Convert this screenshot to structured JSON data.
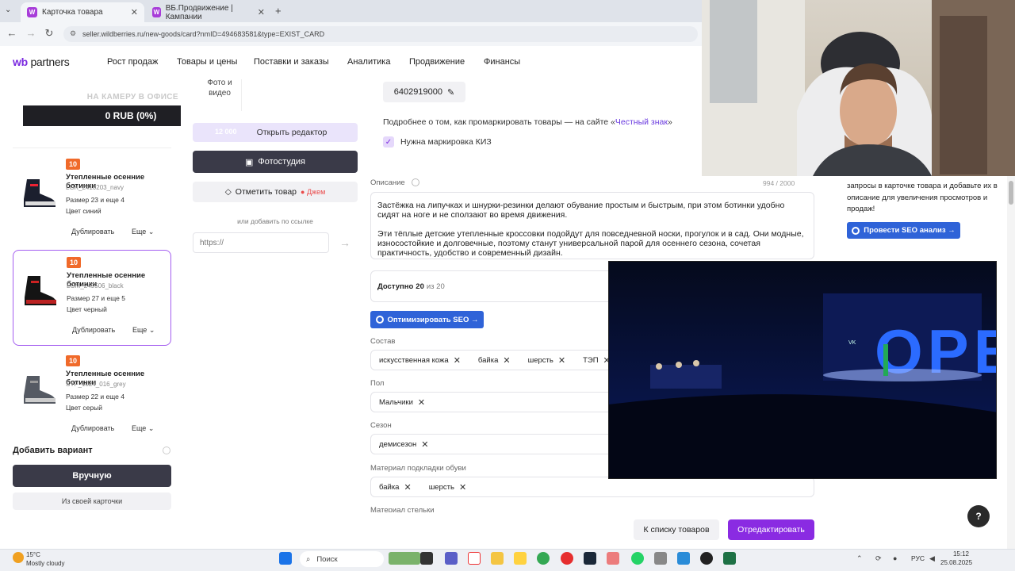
{
  "browser": {
    "tabs": [
      {
        "label": "Карточка товара",
        "favicon": "W"
      },
      {
        "label": "ВБ.Продвижение | Кампании",
        "favicon": "W"
      }
    ],
    "url": "seller.wildberries.ru/new-goods/card?nmID=494683581&type=EXIST_CARD"
  },
  "header": {
    "logo_wb": "wb",
    "logo_partners": "partners",
    "nav": [
      "Рост продаж",
      "Товары и цены",
      "Поставки и заказы",
      "Аналитика",
      "Продвижение",
      "Финансы"
    ]
  },
  "overlay": {
    "promo": "НА КАМЕРУ В ОФИСЕ",
    "balance": "0 RUB (0%)"
  },
  "variants": [
    {
      "badge": "10",
      "title": "Утепленные осенние ботинки",
      "sku": "LGK_2410203_navy",
      "size": "Размер 23 и еще 4",
      "color": "Цвет синий",
      "duplicate": "Дублировать",
      "more": "Еще"
    },
    {
      "badge": "10",
      "title": "Утепленные осенние ботинки",
      "sku": "LGM_249506_black",
      "size": "Размер 27 и еще 5",
      "color": "Цвет черный",
      "duplicate": "Дублировать",
      "more": "Еще"
    },
    {
      "badge": "10",
      "title": "Утепленные осенние ботинки",
      "sku": "SYF_1024_016_grey",
      "size": "Размер 22 и еще 4",
      "color": "Цвет серый",
      "duplicate": "Дублировать",
      "more": "Еще"
    }
  ],
  "add_variant": {
    "title": "Добавить вариант",
    "manual": "Вручную",
    "from_card": "Из своей карточки"
  },
  "media": {
    "photo_label": "Фото и видео",
    "editor_count": "12 000",
    "open_editor": "Открыть редактор",
    "photo_studio": "Фотостудия",
    "mark_product": "Отметить товар",
    "jam": "Джем",
    "or_link": "или добавить по ссылке",
    "url_placeholder": "https://"
  },
  "main": {
    "hs_code": "6402919000",
    "honest_text": "Подробнее о том, как промаркировать товары — на сайте «",
    "honest_link": "Честный знак",
    "honest_end": "»",
    "kiz_label": "Нужна маркировка КИЗ",
    "desc_label": "Описание",
    "desc_count": "994 / 2000",
    "desc_p1": "Застёжка на липучках и шнурки-резинки делают обувание простым и быстрым, при этом ботинки удобно сидят на ноге и не сползают во время движения.",
    "desc_p2": "Эти тёплые детские утепленные кроссовки подойдут для повседневной носки, прогулок и в сад. Они модные, износостойкие и долговечные, поэтому станут универсальной парой для осеннего сезона, сочетая практичность, удобство и современный дизайн.",
    "available_label": "Доступно",
    "available_value": "20",
    "available_of": "из 20",
    "seo_button": "Оптимизировать SEO  →",
    "fields": [
      {
        "label": "Состав",
        "chips": [
          "искусственная кожа",
          "байка",
          "шерсть",
          "ТЭП"
        ]
      },
      {
        "label": "Пол",
        "chips": [
          "Мальчики"
        ]
      },
      {
        "label": "Сезон",
        "chips": [
          "демисезон"
        ]
      },
      {
        "label": "Материал подкладки обуви",
        "chips": [
          "байка",
          "шерсть"
        ]
      }
    ],
    "next_label": "Материал стельки"
  },
  "seo_panel": {
    "text": "запросы в карточке товара и добавьте их в описание для увеличения просмотров и продаж!",
    "button": "Провести SEO анализ  →"
  },
  "video": {
    "sign_text": "OPEN",
    "logo": "VK"
  },
  "footer": {
    "to_list": "К списку товаров",
    "edit": "Отредактировать",
    "help": "?"
  },
  "taskbar": {
    "temp": "15°C",
    "weather": "Mostly cloudy",
    "search": "Поиск",
    "lang": "РУС",
    "time": "15:12",
    "date": "25.08.2025"
  },
  "colors": {
    "accent": "#8a2be2",
    "seo_blue": "#2f63d8",
    "badge_orange": "#f06a2a",
    "dark_btn": "#3a3a48"
  }
}
